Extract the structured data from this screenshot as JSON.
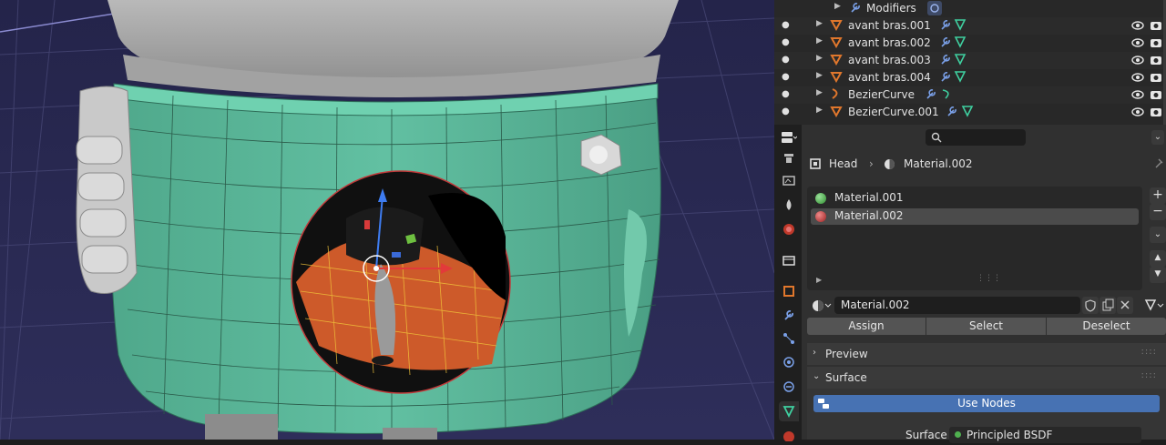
{
  "outliner": {
    "rows": [
      {
        "label": "Modifiers",
        "type": "modifiers"
      },
      {
        "label": "avant bras.001",
        "type": "mesh"
      },
      {
        "label": "avant bras.002",
        "type": "mesh"
      },
      {
        "label": "avant bras.003",
        "type": "mesh"
      },
      {
        "label": "avant bras.004",
        "type": "mesh"
      },
      {
        "label": "BezierCurve",
        "type": "curve"
      },
      {
        "label": "BezierCurve.001",
        "type": "mesh"
      }
    ]
  },
  "properties": {
    "breadcrumb": {
      "object": "Head",
      "material": "Material.002"
    },
    "materials": [
      {
        "name": "Material.001",
        "color": "#4fb04f"
      },
      {
        "name": "Material.002",
        "color": "#c03535",
        "selected": true
      }
    ],
    "material_field": "Material.002",
    "buttons": {
      "assign": "Assign",
      "select": "Select",
      "deselect": "Deselect"
    },
    "panels": {
      "preview": "Preview",
      "surface": "Surface"
    },
    "use_nodes": "Use Nodes",
    "surface_label": "Surface",
    "surface_value": "Principled BSDF"
  },
  "colors": {
    "accent": "#4772b3",
    "mesh_icon": "#e0772c",
    "viewport_bg": "#3d3d3d",
    "mesh_green": "#58b79a"
  }
}
